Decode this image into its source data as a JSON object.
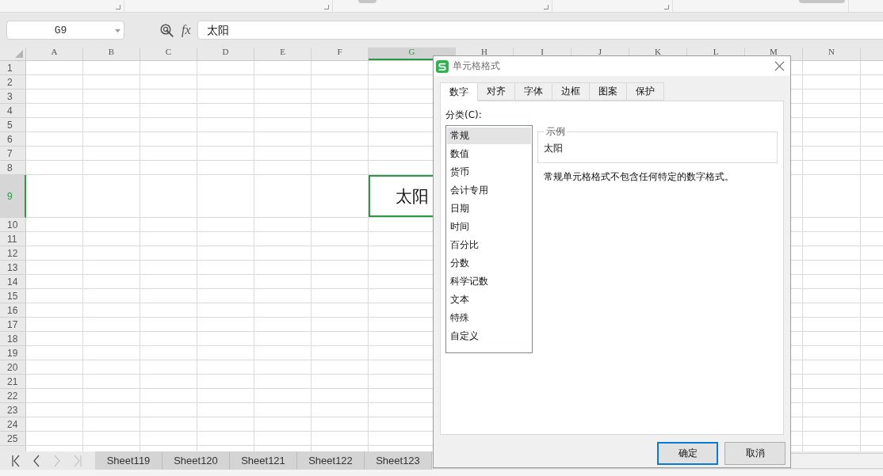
{
  "name_box": {
    "value": "G9"
  },
  "formula_bar": {
    "function_label": "fx",
    "value": "太阳"
  },
  "grid": {
    "columns": [
      {
        "label": "A",
        "selected": false
      },
      {
        "label": "B",
        "selected": false
      },
      {
        "label": "C",
        "selected": false
      },
      {
        "label": "D",
        "selected": false
      },
      {
        "label": "E",
        "selected": false
      },
      {
        "label": "F",
        "selected": false
      },
      {
        "label": "G",
        "selected": true
      },
      {
        "label": "H",
        "selected": false
      },
      {
        "label": "I",
        "selected": false
      },
      {
        "label": "J",
        "selected": false
      },
      {
        "label": "K",
        "selected": false
      },
      {
        "label": "L",
        "selected": false
      },
      {
        "label": "M",
        "selected": false
      },
      {
        "label": "N",
        "selected": false
      }
    ],
    "rows": [
      {
        "label": "1",
        "selected": false
      },
      {
        "label": "2",
        "selected": false
      },
      {
        "label": "3",
        "selected": false
      },
      {
        "label": "4",
        "selected": false
      },
      {
        "label": "5",
        "selected": false
      },
      {
        "label": "6",
        "selected": false
      },
      {
        "label": "7",
        "selected": false
      },
      {
        "label": "8",
        "selected": false
      },
      {
        "label": "9",
        "selected": true
      },
      {
        "label": "10",
        "selected": false
      },
      {
        "label": "11",
        "selected": false
      },
      {
        "label": "12",
        "selected": false
      },
      {
        "label": "13",
        "selected": false
      },
      {
        "label": "14",
        "selected": false
      },
      {
        "label": "15",
        "selected": false
      },
      {
        "label": "16",
        "selected": false
      },
      {
        "label": "17",
        "selected": false
      },
      {
        "label": "18",
        "selected": false
      },
      {
        "label": "19",
        "selected": false
      },
      {
        "label": "20",
        "selected": false
      },
      {
        "label": "21",
        "selected": false
      },
      {
        "label": "22",
        "selected": false
      },
      {
        "label": "23",
        "selected": false
      },
      {
        "label": "24",
        "selected": false
      },
      {
        "label": "25",
        "selected": false
      }
    ],
    "active_cell_text": "太阳"
  },
  "sheet_nav": [
    {
      "kind": "first",
      "disabled": false
    },
    {
      "kind": "previous",
      "disabled": false
    },
    {
      "kind": "next",
      "disabled": true
    },
    {
      "kind": "last",
      "disabled": true
    }
  ],
  "sheet_tabs": [
    {
      "label": "Sheet119",
      "selected": false
    },
    {
      "label": "Sheet120",
      "selected": false
    },
    {
      "label": "Sheet121",
      "selected": false
    },
    {
      "label": "Sheet122",
      "selected": false
    },
    {
      "label": "Sheet123",
      "selected": false
    }
  ],
  "dialog": {
    "title": "单元格格式",
    "tabs": [
      {
        "label": "数字",
        "selected": true
      },
      {
        "label": "对齐",
        "selected": false
      },
      {
        "label": "字体",
        "selected": false
      },
      {
        "label": "边框",
        "selected": false
      },
      {
        "label": "图案",
        "selected": false
      },
      {
        "label": "保护",
        "selected": false
      }
    ],
    "category_label": "分类(C):",
    "categories": [
      {
        "label": "常规",
        "selected": true
      },
      {
        "label": "数值",
        "selected": false
      },
      {
        "label": "货币",
        "selected": false
      },
      {
        "label": "会计专用",
        "selected": false
      },
      {
        "label": "日期",
        "selected": false
      },
      {
        "label": "时间",
        "selected": false
      },
      {
        "label": "百分比",
        "selected": false
      },
      {
        "label": "分数",
        "selected": false
      },
      {
        "label": "科学记数",
        "selected": false
      },
      {
        "label": "文本",
        "selected": false
      },
      {
        "label": "特殊",
        "selected": false
      },
      {
        "label": "自定义",
        "selected": false
      }
    ],
    "sample_legend": "示例",
    "sample_value": "太阳",
    "description": "常规单元格格式不包含任何特定的数字格式。",
    "buttons": [
      {
        "label": "确定",
        "default": true
      },
      {
        "label": "取消",
        "default": false
      }
    ]
  }
}
